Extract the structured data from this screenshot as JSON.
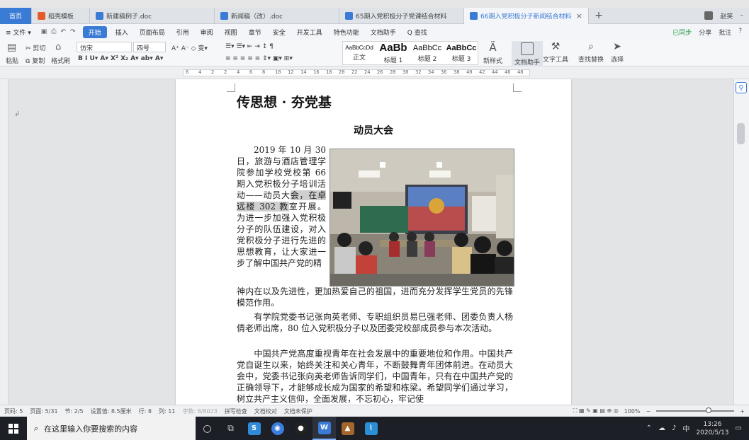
{
  "tabs": [
    {
      "label": "首页",
      "kind": "home"
    },
    {
      "label": "稻壳模板",
      "kind": "docer",
      "color": "#e55a2b"
    },
    {
      "label": "新建稿例子.doc",
      "kind": "doc",
      "color": "#3a7bd5"
    },
    {
      "label": "新闻稿（改）.doc",
      "kind": "doc",
      "color": "#3a7bd5"
    },
    {
      "label": "65期入党积极分子党课结合材料",
      "kind": "doc",
      "color": "#3a7bd5"
    },
    {
      "label": "66期入党积极分子新闻结合材料",
      "kind": "doc",
      "color": "#3a7bd5",
      "active": true
    }
  ],
  "tabbar": {
    "add": "+",
    "user": "赵笑",
    "minimize": "–"
  },
  "menu": {
    "file": "≡ 文件 ▾",
    "items": [
      "开始",
      "插入",
      "页面布局",
      "引用",
      "审阅",
      "视图",
      "章节",
      "安全",
      "开发工具",
      "特色功能",
      "文档助手"
    ],
    "search": "Q 查找",
    "right": [
      "已同步",
      "分享",
      "批注",
      "?"
    ]
  },
  "ribbon": {
    "cut": "剪切",
    "paste": "粘贴",
    "copy": "复制",
    "format_painter": "格式刷",
    "font": "仿宋",
    "size": "四号",
    "styles": [
      {
        "sample": "AaBbCcDd",
        "name": "正文"
      },
      {
        "sample": "AaBb",
        "name": "标题 1"
      },
      {
        "sample": "AaBbCc",
        "name": "标题 2"
      },
      {
        "sample": "AaBbCc",
        "name": "标题 3"
      }
    ],
    "new_style": "新样式",
    "doc_assistant": "文档助手",
    "text_tools": "文字工具",
    "find_replace": "查找替换",
    "select": "选择"
  },
  "ruler": {
    "numbers": [
      "6",
      "4",
      "2",
      "2",
      "4",
      "6",
      "8",
      "10",
      "12",
      "14",
      "16",
      "18",
      "20",
      "22",
      "24",
      "26",
      "28",
      "30",
      "32",
      "34",
      "36",
      "38",
      "40",
      "42",
      "44",
      "46",
      "48"
    ]
  },
  "document": {
    "title": "传思想 · 夯党基",
    "subtitle": "动员大会",
    "para1_a": "2019 年 10 月 30 日，旅游与酒店管理学院参加学校党校第 66 期入党积极分子培训活动——动员大",
    "para1_hl": "会，在卓远楼 302 教",
    "para1_b": "室开展。为进一步加强入党积极分子的队伍建设，对入党积极分子进行先进的思想教育，让大家进一步了解中国共产党的精",
    "para1_c": "神内在以及先进性，更加热爱自己的祖国，进而充分发挥学生党员的先锋模范作用。",
    "para2": "　　有学院党委书记张向英老师、专职组织员易巳强老师、团委负责人杨倩老师出席，80 位入党积极分子以及团委党校部成员参与本次活动。",
    "para3": "　　中国共产党高度重视青年在社会发展中的重要地位和作用。中国共产党自诞生以来，始终关注和关心青年，不断鼓舞青年团体前进。在动员大会中，党委书记张向英老师告诉同学们，中国青年，只有在中国共产党的正确领导下，才能够成长成为国家的希望和栋梁。希望同学们通过学习，树立共产主义信仰，全面发展，不忘初心，牢记使"
  },
  "status": {
    "left": [
      "页码: 5",
      "页面: 5/31",
      "节: 2/5",
      "设置值: 8.5厘米",
      "行: 8",
      "列: 11",
      "字数: 8/8023",
      "拼写检查",
      "文档校对",
      "文档未保护"
    ],
    "zoom": "100%"
  },
  "taskbar": {
    "search_placeholder": "在这里输入你要搜索的内容",
    "time": "13:26",
    "date": "2020/5/13",
    "ime": "中"
  }
}
